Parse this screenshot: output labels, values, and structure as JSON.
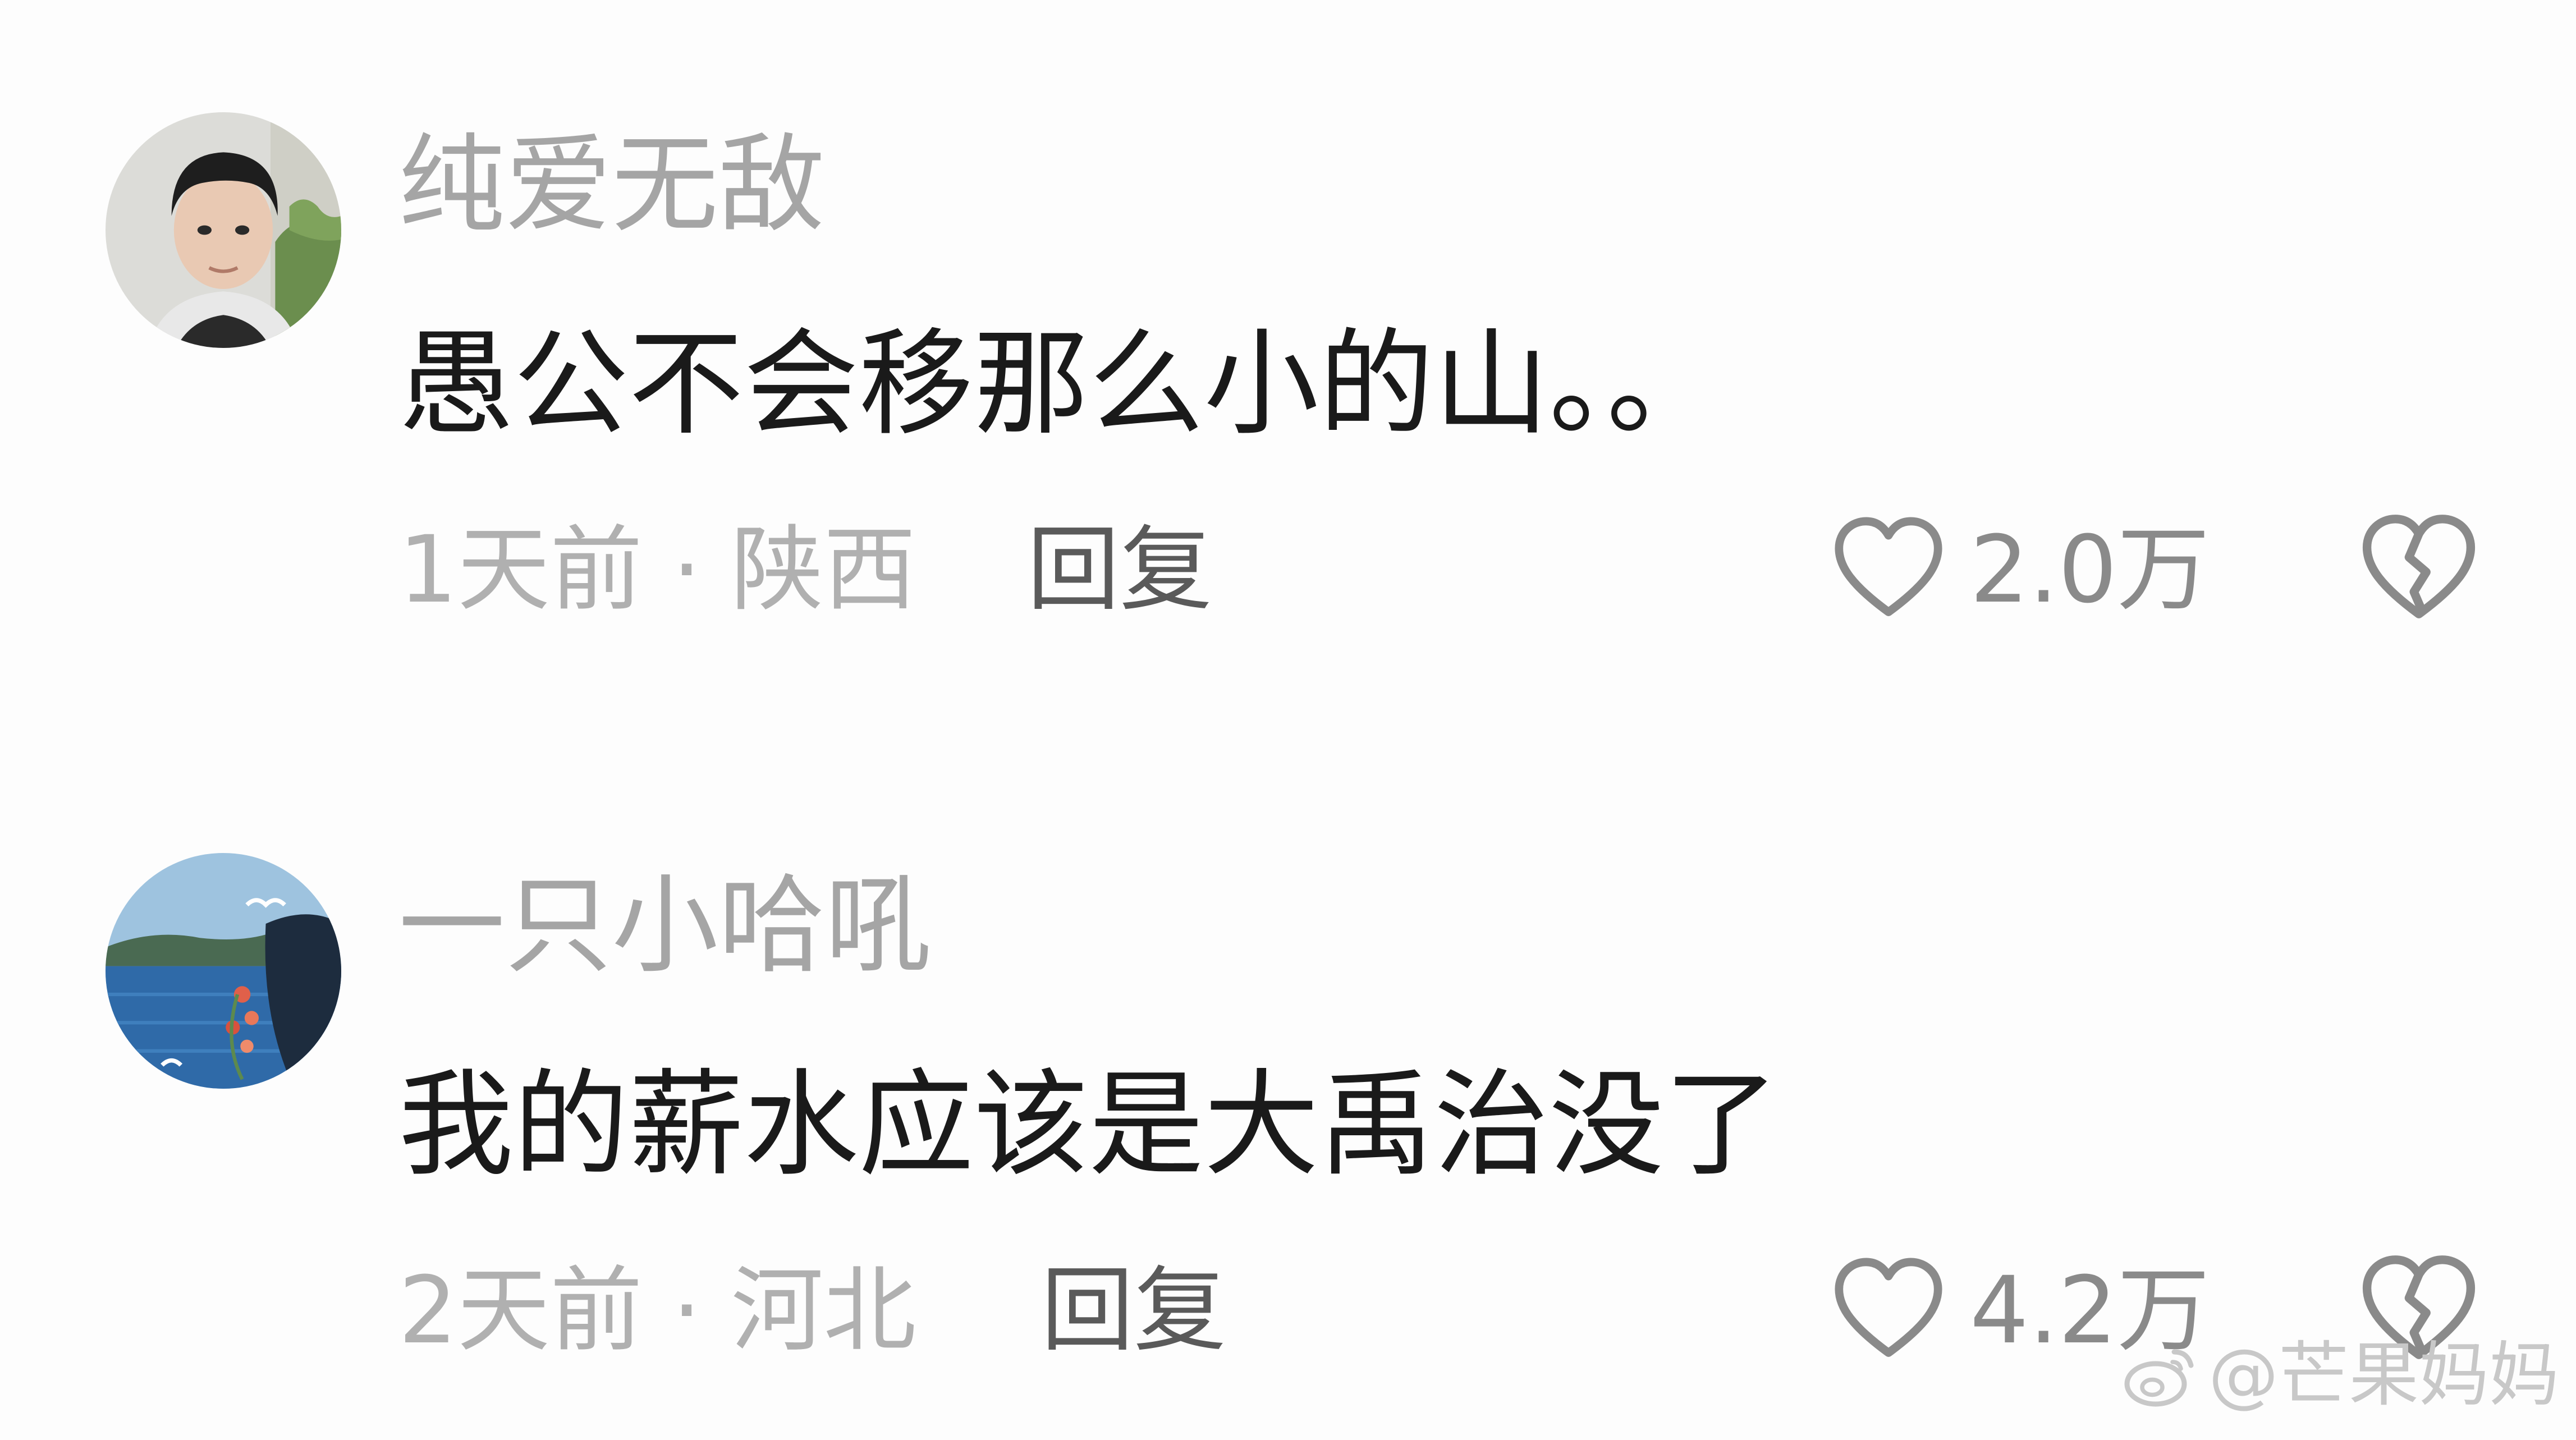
{
  "comments": [
    {
      "username": "纯爱无敌",
      "content": "愚公不会移那么小的山。。",
      "time": "1天前",
      "separator": "·",
      "location": "陕西",
      "reply_label": "回复",
      "like_count": "2.0万",
      "avatar_icon": "avatar-man-photo"
    },
    {
      "username": "一只小哈吼",
      "content": "我的薪水应该是大禹治没了",
      "time": "2天前",
      "separator": "·",
      "location": "河北",
      "reply_label": "回复",
      "like_count": "4.2万",
      "avatar_icon": "avatar-seaside-photo"
    }
  ],
  "icons": {
    "like": "heart-outline-icon",
    "dislike": "broken-heart-icon",
    "watermark": "weibo-icon"
  },
  "watermark": {
    "text": "@芒果妈妈"
  },
  "colors": {
    "background": "#fdfdfd",
    "username": "#a5a5a5",
    "content": "#1a1a1a",
    "meta": "#b0b0b0",
    "reply": "#5a5a5a",
    "icon": "#8a8a8a"
  }
}
